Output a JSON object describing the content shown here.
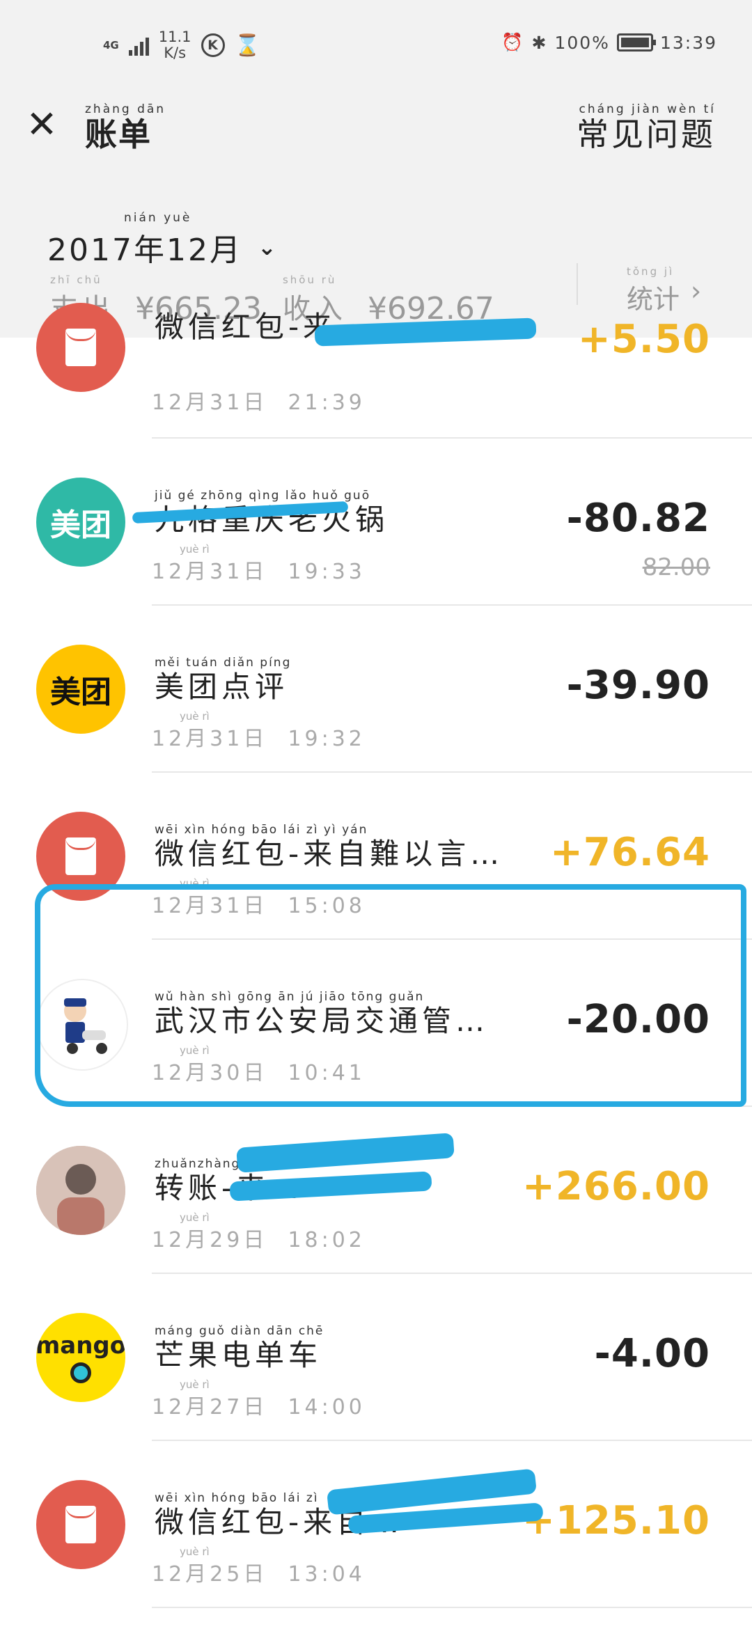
{
  "status_bar": {
    "network": "4G",
    "speed": "11.1",
    "speed_unit": "K/s",
    "k_icon_letter": "K",
    "battery_pct": "100%",
    "time": "13:39"
  },
  "header": {
    "title_pinyin": "zhàng dān",
    "title": "账单",
    "faq_pinyin": "cháng jiàn wèn tí",
    "faq": "常见问题"
  },
  "summary": {
    "month_pinyin": "nián yuè",
    "month": "2017年12月",
    "expense_pinyin": "zhī chū",
    "expense_label": "支出",
    "expense_value": "¥665.23",
    "income_pinyin": "shōu rù",
    "income_label": "收入",
    "income_value": "¥692.67",
    "stats_pinyin": "tǒng jì",
    "stats_label": "统计"
  },
  "transactions": [
    {
      "name_pinyin": "",
      "name": "微信红包-来…",
      "date_pinyin": "yuè rì",
      "date": "12月31日",
      "time": "21:39",
      "amount": "+5.50",
      "icon": "red-packet-icon"
    },
    {
      "name_pinyin": "jiǔ gé zhōng qìng lǎo huǒ guō",
      "name": "九格重庆老火锅",
      "date_pinyin": "yuè rì",
      "date": "12月31日",
      "time": "19:33",
      "amount": "-80.82",
      "original_amount": "82.00",
      "icon": "meituan-icon"
    },
    {
      "name_pinyin": "měi tuán diǎn píng",
      "name": "美团点评",
      "date_pinyin": "yuè rì",
      "date": "12月31日",
      "time": "19:32",
      "amount": "-39.90",
      "icon": "meituan-icon"
    },
    {
      "name_pinyin": "wēi xìn hóng bāo lái zì yì yán",
      "name": "微信红包-来自難以言…",
      "date_pinyin": "yuè rì",
      "date": "12月31日",
      "time": "15:08",
      "amount": "+76.64",
      "icon": "red-packet-icon"
    },
    {
      "name_pinyin": "wǔ hàn shì gōng ān jú jiāo tōng guǎn",
      "name": "武汉市公安局交通管…",
      "date_pinyin": "yuè rì",
      "date": "12月30日",
      "time": "10:41",
      "amount": "-20.00",
      "icon": "traffic-police-icon"
    },
    {
      "name_pinyin": "zhuǎnzhàng lái",
      "name": "转账-来…",
      "date_pinyin": "yuè rì",
      "date": "12月29日",
      "time": "18:02",
      "amount": "+266.00",
      "icon": "user-avatar"
    },
    {
      "name_pinyin": "máng guǒ diàn dān chē",
      "name": "芒果电单车",
      "date_pinyin": "yuè rì",
      "date": "12月27日",
      "time": "14:00",
      "amount": "-4.00",
      "icon": "mango-icon"
    },
    {
      "name_pinyin": "wēi xìn hóng bāo lái zì",
      "name": "微信红包-来自…",
      "date_pinyin": "yuè rì",
      "date": "12月25日",
      "time": "13:04",
      "amount": "+125.10",
      "icon": "red-packet-icon"
    }
  ],
  "icons": {
    "meituan_text": "美团",
    "mango_text": "mango"
  },
  "colors": {
    "income": "#f0b528",
    "expense": "#222222",
    "red_packet": "#e25c4f",
    "annotation": "#27aae1"
  }
}
